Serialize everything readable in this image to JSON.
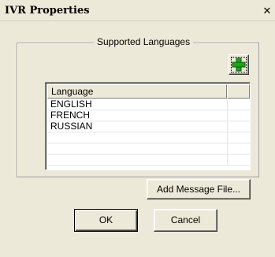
{
  "window": {
    "title": "IVR Properties",
    "close_label": "✕"
  },
  "group": {
    "legend": "Supported Languages",
    "add_language_icon": "green-plus-icon"
  },
  "list": {
    "columns": [
      "Language",
      ""
    ],
    "rows": [
      "ENGLISH",
      "FRENCH",
      "RUSSIAN",
      "",
      "",
      "",
      ""
    ]
  },
  "buttons": {
    "add_message_file": "Add Message File...",
    "ok": "OK",
    "cancel": "Cancel"
  },
  "colors": {
    "dialog_bg": "#ece9d8",
    "plus_green": "#1fa21f"
  }
}
